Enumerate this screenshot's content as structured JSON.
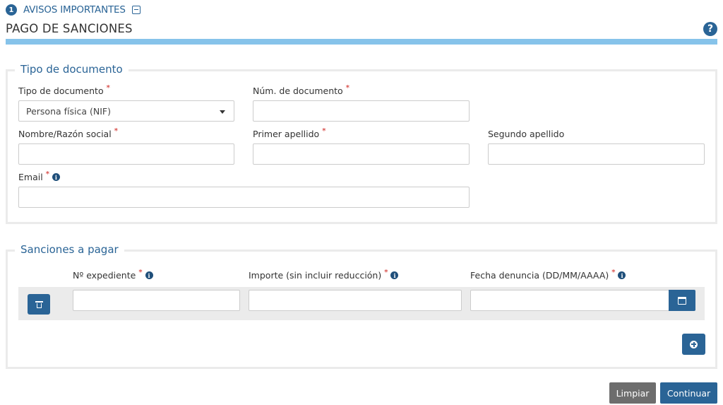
{
  "avisos": {
    "badge": "1",
    "label": "AVISOS IMPORTANTES"
  },
  "page": {
    "title": "PAGO DE SANCIONES",
    "help": "?"
  },
  "documento": {
    "legend": "Tipo de documento",
    "tipo_label": "Tipo de documento",
    "tipo_value": "Persona física (NIF)",
    "num_label": "Núm. de documento",
    "nombre_label": "Nombre/Razón social",
    "primer_label": "Primer apellido",
    "segundo_label": "Segundo apellido",
    "email_label": "Email",
    "required_mark": "*",
    "info_mark": "i"
  },
  "sanciones": {
    "legend": "Sanciones a pagar",
    "expediente_label": "Nº expediente",
    "importe_label": "Importe (sin incluir reducción)",
    "fecha_label": "Fecha denuncia (DD/MM/AAAA)"
  },
  "actions": {
    "limpiar": "Limpiar",
    "continuar": "Continuar"
  },
  "colors": {
    "primary": "#2a6496",
    "accent_bar": "#86c3ea",
    "required": "#d9534f",
    "secondary_button": "#6d6d6d"
  }
}
